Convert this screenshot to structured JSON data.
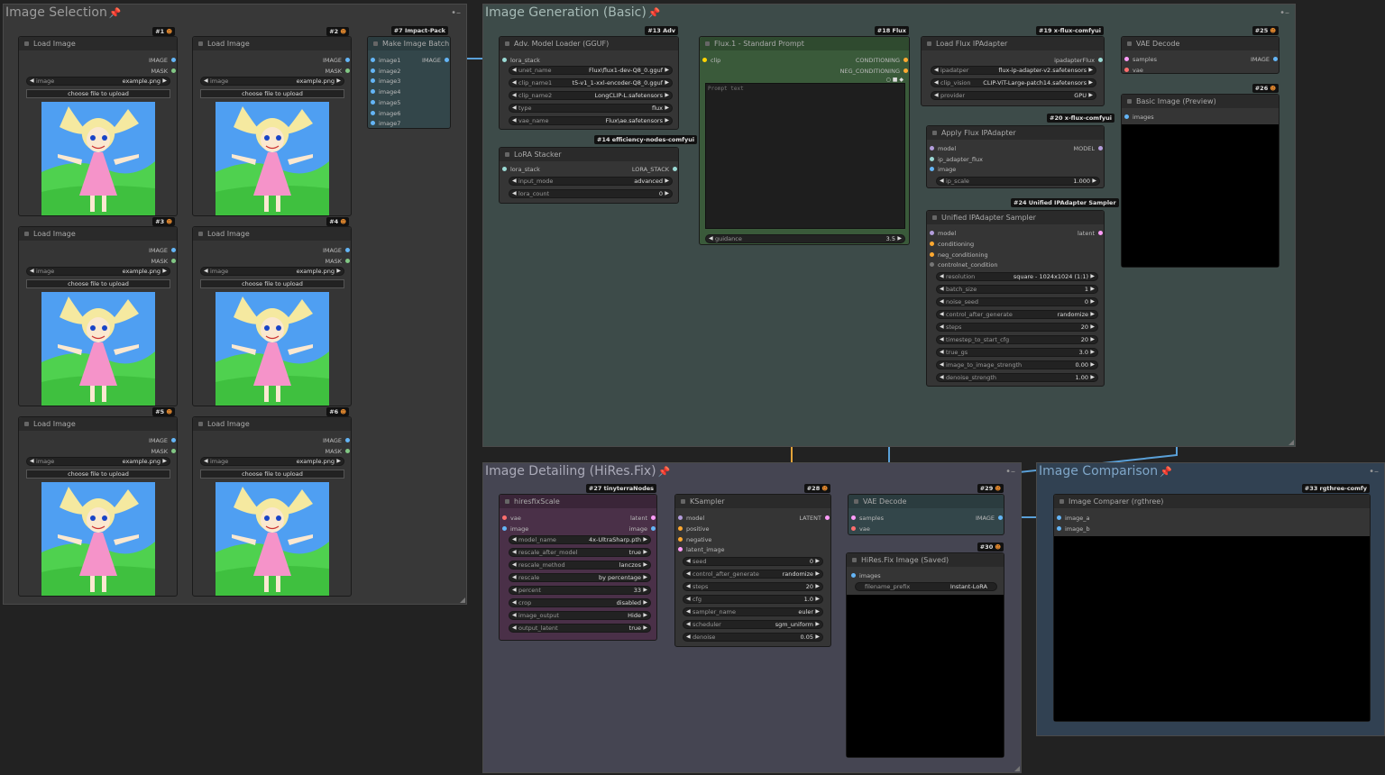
{
  "groups": {
    "image_selection": {
      "title": "Image Selection",
      "color": "#3c3c3c"
    },
    "image_generation": {
      "title": "Image Generation (Basic)",
      "color": "#3a4a48"
    },
    "image_detailing": {
      "title": "Image Detailing (HiRes.Fix)",
      "color": "#444450"
    },
    "image_comparison": {
      "title": "Image Comparison",
      "color": "#2f3e4e"
    }
  },
  "load_image": {
    "title": "Load Image",
    "out_image": "IMAGE",
    "out_mask": "MASK",
    "widget_label": "image",
    "widget_value": "example.png",
    "upload_label": "choose file to upload",
    "badges": [
      "#1",
      "#2",
      "#3",
      "#4",
      "#5",
      "#6"
    ]
  },
  "make_batch": {
    "title": "Make Image Batch",
    "badge": "#7 Impact-Pack",
    "inputs": [
      "image1",
      "image2",
      "image3",
      "image4",
      "image5",
      "image6",
      "image7"
    ],
    "output": "IMAGE"
  },
  "adv_loader": {
    "title": "Adv. Model Loader (GGUF)",
    "badge": "#13 Adv",
    "input": "lora_stack",
    "widgets": [
      {
        "label": "unet_name",
        "value": "Flux\\flux1-dev-Q8_0.gguf"
      },
      {
        "label": "clip_name1",
        "value": "t5-v1_1-xxl-encoder-Q8_0.gguf"
      },
      {
        "label": "clip_name2",
        "value": "LongCLIP-L.safetensors"
      },
      {
        "label": "type",
        "value": "flux"
      },
      {
        "label": "vae_name",
        "value": "Flux\\ae.safetensors"
      }
    ]
  },
  "lora_stacker": {
    "title": "LoRA Stacker",
    "badge": "#14 efficiency-nodes-comfyui",
    "input": "lora_stack",
    "output": "LORA_STACK",
    "widgets": [
      {
        "label": "input_mode",
        "value": "advanced"
      },
      {
        "label": "lora_count",
        "value": "0"
      }
    ]
  },
  "flux_prompt": {
    "title": "Flux.1 - Standard Prompt",
    "badge": "#18 Flux",
    "input": "clip",
    "out1": "CONDITIONING",
    "out2": "NEG_CONDITIONING",
    "placeholder": "Prompt text",
    "widget": {
      "label": "guidance",
      "value": "3.5"
    }
  },
  "load_ipadapter": {
    "title": "Load Flux IPAdapter",
    "badge": "#19 x-flux-comfyui",
    "output": "ipadapterFlux",
    "widgets": [
      {
        "label": "ipadatper",
        "value": "flux-ip-adapter-v2.safetensors"
      },
      {
        "label": "clip_vision",
        "value": "CLIP-ViT-Large-patch14.safetensors"
      },
      {
        "label": "provider",
        "value": "GPU"
      }
    ]
  },
  "apply_ipadapter": {
    "title": "Apply Flux IPAdapter",
    "badge": "#20 x-flux-comfyui",
    "inputs": [
      "model",
      "ip_adapter_flux",
      "image"
    ],
    "output": "MODEL",
    "widget": {
      "label": "ip_scale",
      "value": "1.000"
    }
  },
  "sampler": {
    "title": "Unified IPAdapter Sampler",
    "badge": "#24 Unified IPAdapter Sampler",
    "inputs": [
      "model",
      "conditioning",
      "neg_conditioning",
      "controlnet_condition"
    ],
    "output": "latent",
    "widgets": [
      {
        "label": "resolution",
        "value": "square - 1024x1024 (1:1)"
      },
      {
        "label": "batch_size",
        "value": "1"
      },
      {
        "label": "noise_seed",
        "value": "0"
      },
      {
        "label": "control_after_generate",
        "value": "randomize"
      },
      {
        "label": "steps",
        "value": "20"
      },
      {
        "label": "timestep_to_start_cfg",
        "value": "20"
      },
      {
        "label": "true_gs",
        "value": "3.0"
      },
      {
        "label": "image_to_image_strength",
        "value": "0.00"
      },
      {
        "label": "denoise_strength",
        "value": "1.00"
      }
    ]
  },
  "vae_decode1": {
    "title": "VAE Decode",
    "badge": "#25",
    "inputs": [
      "samples",
      "vae"
    ],
    "output": "IMAGE"
  },
  "preview": {
    "title": "Basic Image (Preview)",
    "badge": "#26",
    "input": "images"
  },
  "hires": {
    "title": "hiresfixScale",
    "badge": "#27 tinyterraNodes",
    "inputs": [
      "vae",
      "image"
    ],
    "outputs": [
      "latent",
      "image"
    ],
    "widgets": [
      {
        "label": "model_name",
        "value": "4x-UltraSharp.pth"
      },
      {
        "label": "rescale_after_model",
        "value": "true"
      },
      {
        "label": "rescale_method",
        "value": "lanczos"
      },
      {
        "label": "rescale",
        "value": "by percentage"
      },
      {
        "label": "percent",
        "value": "33"
      },
      {
        "label": "crop",
        "value": "disabled"
      },
      {
        "label": "image_output",
        "value": "Hide"
      },
      {
        "label": "output_latent",
        "value": "true"
      }
    ]
  },
  "ksampler": {
    "title": "KSampler",
    "badge": "#28",
    "inputs": [
      "model",
      "positive",
      "negative",
      "latent_image"
    ],
    "output": "LATENT",
    "widgets": [
      {
        "label": "seed",
        "value": "0"
      },
      {
        "label": "control_after_generate",
        "value": "randomize"
      },
      {
        "label": "steps",
        "value": "20"
      },
      {
        "label": "cfg",
        "value": "1.0"
      },
      {
        "label": "sampler_name",
        "value": "euler"
      },
      {
        "label": "scheduler",
        "value": "sgm_uniform"
      },
      {
        "label": "denoise",
        "value": "0.05"
      }
    ]
  },
  "vae_decode2": {
    "title": "VAE Decode",
    "badge": "#29",
    "inputs": [
      "samples",
      "vae"
    ],
    "output": "IMAGE"
  },
  "save": {
    "title": "HiRes.Fix Image (Saved)",
    "badge": "#30",
    "input": "images",
    "widget": {
      "label": "filename_prefix",
      "value": "Instant-LoRA"
    }
  },
  "comparer": {
    "title": "Image Comparer (rgthree)",
    "badge": "#33 rgthree-comfy",
    "inputs": [
      "image_a",
      "image_b"
    ]
  },
  "colors": {
    "image": "#64b5f6",
    "mask": "#81c784",
    "model": "#b39ddb",
    "cond": "#ffa931",
    "latent": "#ff9cf9",
    "vae": "#ff6e6e",
    "clip": "#ffd500",
    "lora": "#9ad9d4",
    "ipa": "#9ad9d4",
    "wire_image": "#5aa0d8",
    "wire_cond": "#e3a33a",
    "wire_latent": "#e07be0"
  }
}
